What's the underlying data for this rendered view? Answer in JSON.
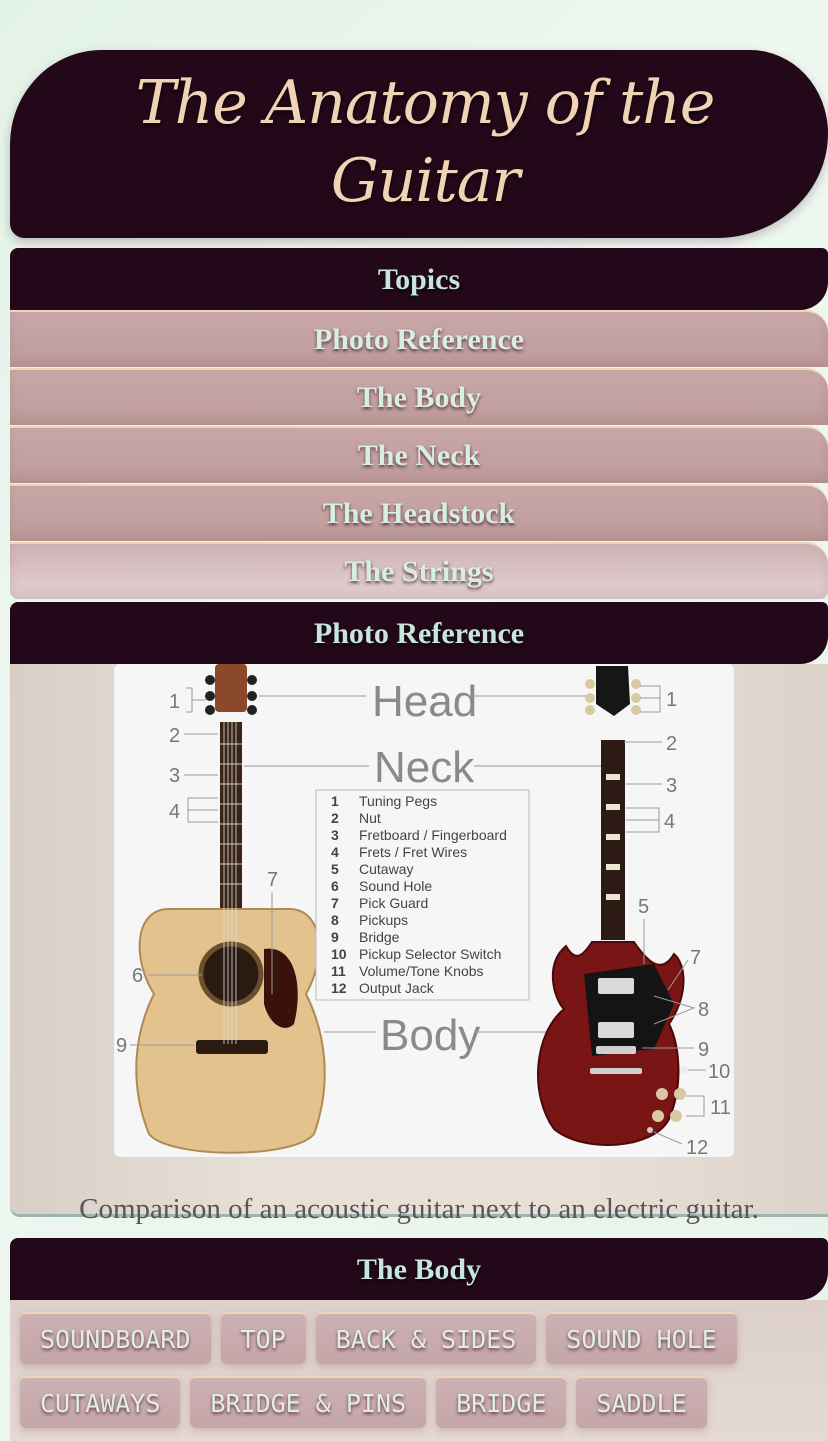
{
  "page": {
    "title": "The Anatomy of the Guitar"
  },
  "topics": {
    "header": "Topics",
    "items": [
      {
        "label": "Photo Reference"
      },
      {
        "label": "The Body"
      },
      {
        "label": "The Neck"
      },
      {
        "label": "The Headstock"
      },
      {
        "label": "The Strings"
      }
    ]
  },
  "photo_reference": {
    "header": "Photo Reference",
    "image": {
      "big_labels": {
        "head": "Head",
        "neck": "Neck",
        "body": "Body"
      },
      "legend": [
        {
          "num": "1",
          "label": "Tuning Pegs"
        },
        {
          "num": "2",
          "label": "Nut"
        },
        {
          "num": "3",
          "label": "Fretboard / Fingerboard"
        },
        {
          "num": "4",
          "label": "Frets / Fret Wires"
        },
        {
          "num": "5",
          "label": "Cutaway"
        },
        {
          "num": "6",
          "label": "Sound Hole"
        },
        {
          "num": "7",
          "label": "Pick Guard"
        },
        {
          "num": "8",
          "label": "Pickups"
        },
        {
          "num": "9",
          "label": "Bridge"
        },
        {
          "num": "10",
          "label": "Pickup Selector Switch"
        },
        {
          "num": "11",
          "label": "Volume/Tone Knobs"
        },
        {
          "num": "12",
          "label": "Output Jack"
        }
      ],
      "acoustic_callouts": [
        "1",
        "2",
        "3",
        "4",
        "7",
        "6",
        "9"
      ],
      "electric_callouts": [
        "1",
        "2",
        "3",
        "4",
        "5",
        "7",
        "8",
        "9",
        "10",
        "11",
        "12"
      ]
    },
    "caption": "Comparison of an acoustic guitar next to an electric guitar."
  },
  "body_section": {
    "header": "The Body",
    "chips": [
      {
        "label": "SOUNDBOARD"
      },
      {
        "label": "TOP"
      },
      {
        "label": "BACK & SIDES"
      },
      {
        "label": "SOUND HOLE"
      },
      {
        "label": "CUTAWAYS"
      },
      {
        "label": "BRIDGE & PINS"
      },
      {
        "label": "BRIDGE"
      },
      {
        "label": "SADDLE"
      }
    ]
  },
  "colors": {
    "header_bg": "#220818",
    "title_text": "#f0d2b4",
    "topic_bg": "#c8a7a6",
    "topic_text": "#d7eee4",
    "page_bg": "#e6f3ea"
  }
}
